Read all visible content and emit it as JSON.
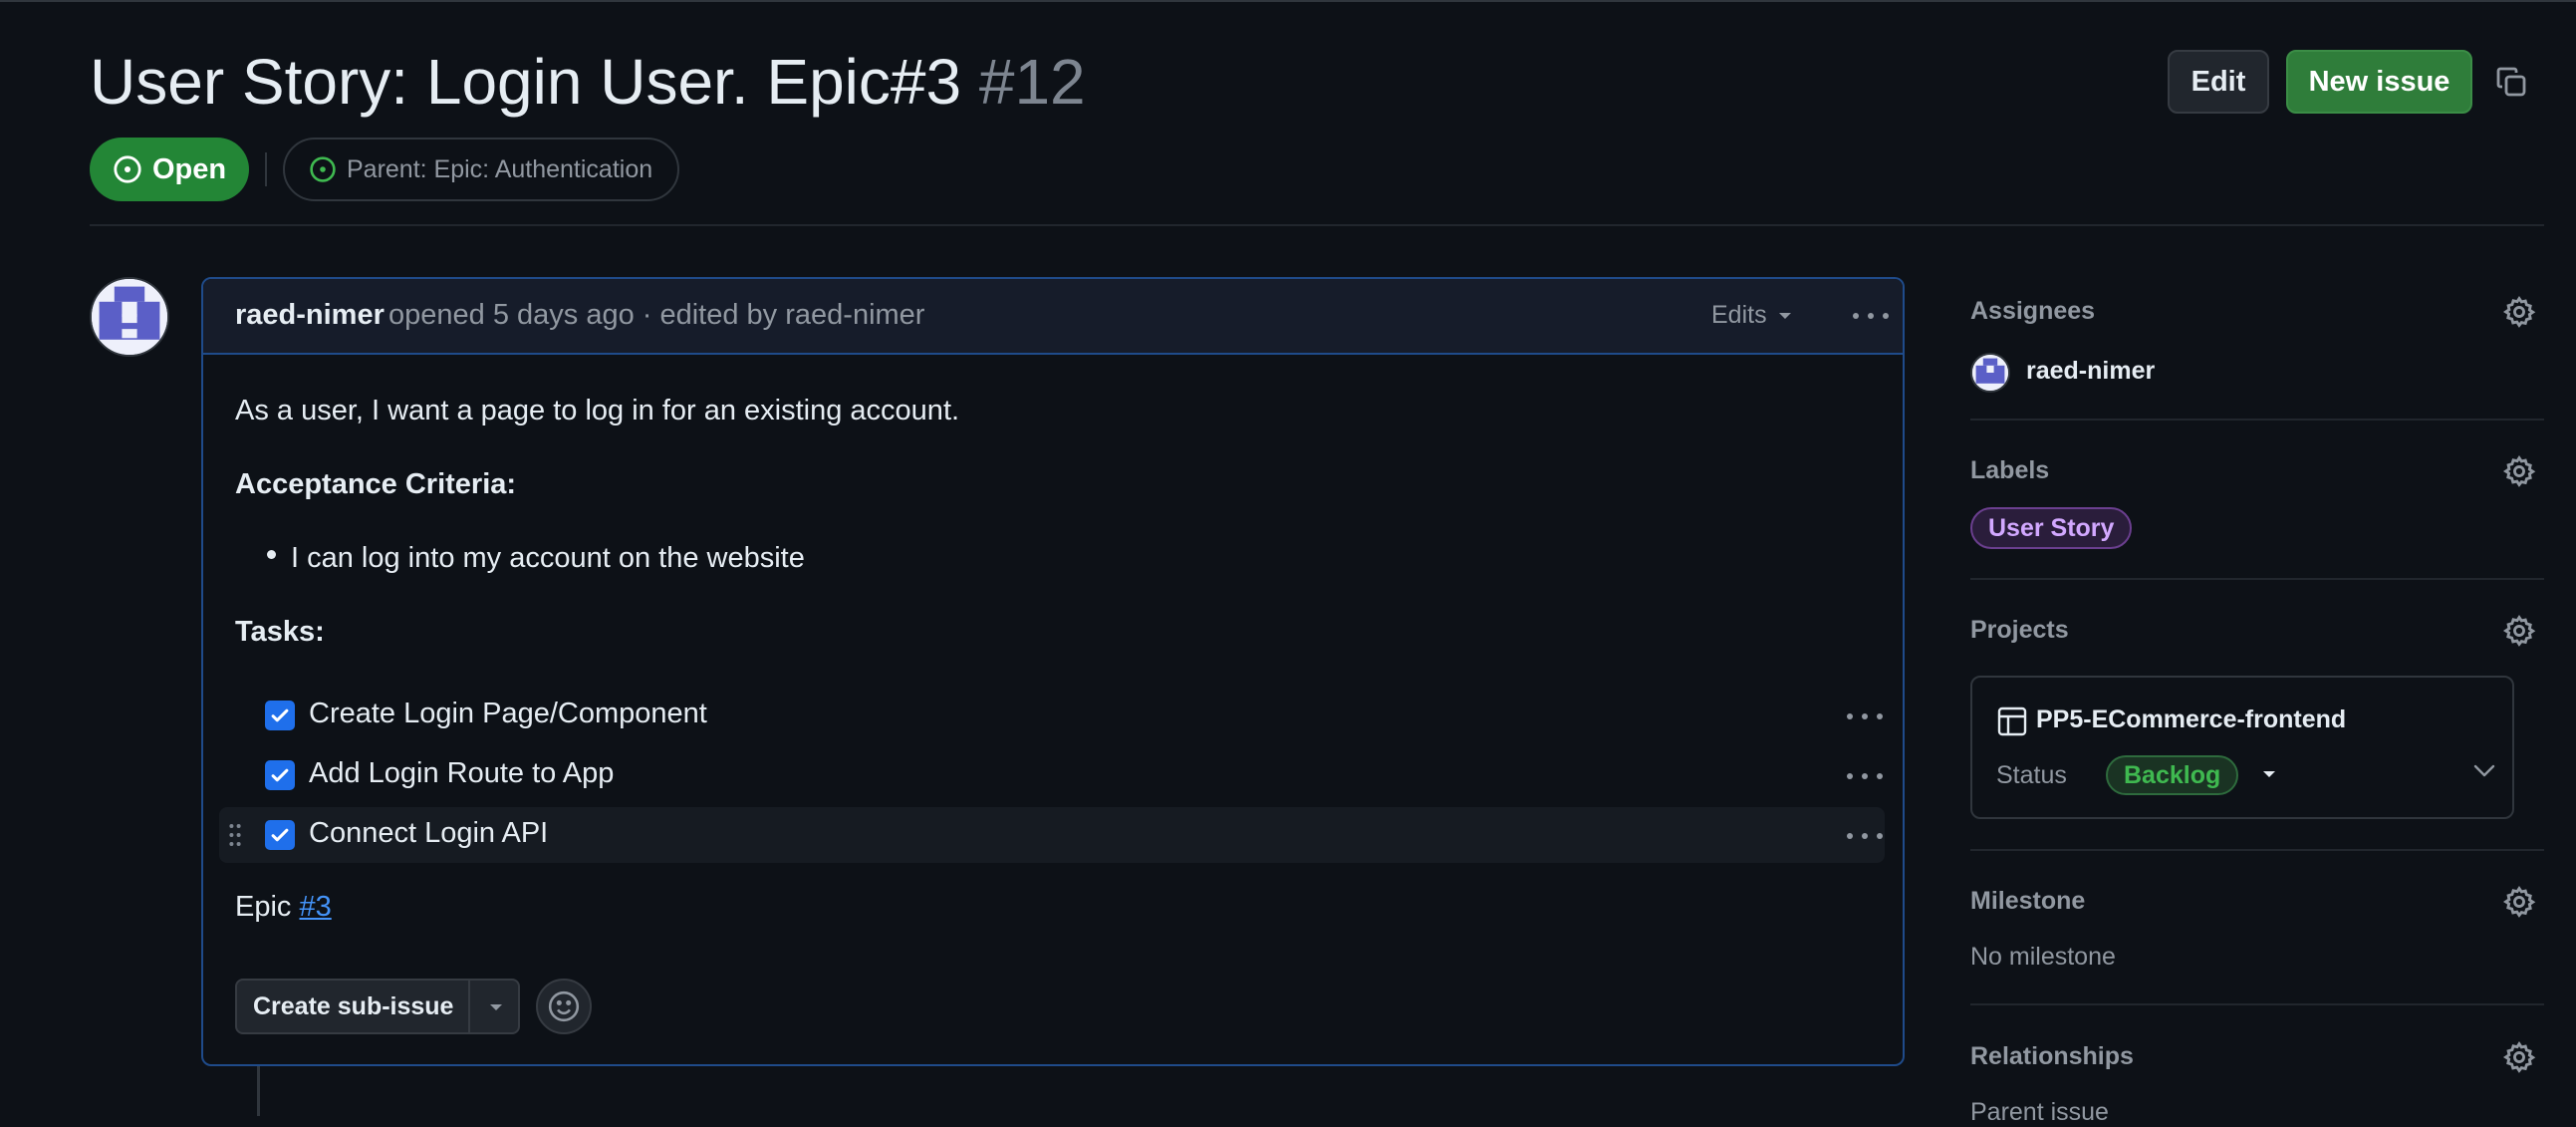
{
  "issue": {
    "title": "User Story: Login User. Epic#3",
    "number": "#12",
    "state": "Open",
    "parent_label": "Parent: Epic: Authentication"
  },
  "header": {
    "edit_label": "Edit",
    "new_issue_label": "New issue"
  },
  "comment": {
    "author": "raed-nimer",
    "meta": "opened 5 days ago · edited by raed-nimer",
    "edits_label": "Edits",
    "intro": "As a user, I want a page to log in for an existing account.",
    "criteria_heading": "Acceptance Criteria:",
    "criteria": [
      "I can log into my account on the website"
    ],
    "tasks_heading": "Tasks:",
    "tasks": [
      {
        "label": "Create Login Page/Component",
        "checked": true
      },
      {
        "label": "Add Login Route to App",
        "checked": true
      },
      {
        "label": "Connect Login API",
        "checked": true
      }
    ],
    "epic_prefix": "Epic",
    "epic_link": "#3",
    "create_sub_issue_label": "Create sub-issue"
  },
  "sidebar": {
    "assignees_heading": "Assignees",
    "assignee": "raed-nimer",
    "labels_heading": "Labels",
    "labels": [
      "User Story"
    ],
    "projects_heading": "Projects",
    "project_name": "PP5-ECommerce-frontend",
    "status_label": "Status",
    "status_value": "Backlog",
    "milestone_heading": "Milestone",
    "milestone_value": "No milestone",
    "relationships_heading": "Relationships",
    "relationships_value": "Parent issue"
  },
  "colors": {
    "accent_green": "#238636",
    "link_blue": "#4493f8",
    "label_purple": "#d2a8ff",
    "status_green": "#3fb950",
    "checkbox_blue": "#1f6feb"
  }
}
